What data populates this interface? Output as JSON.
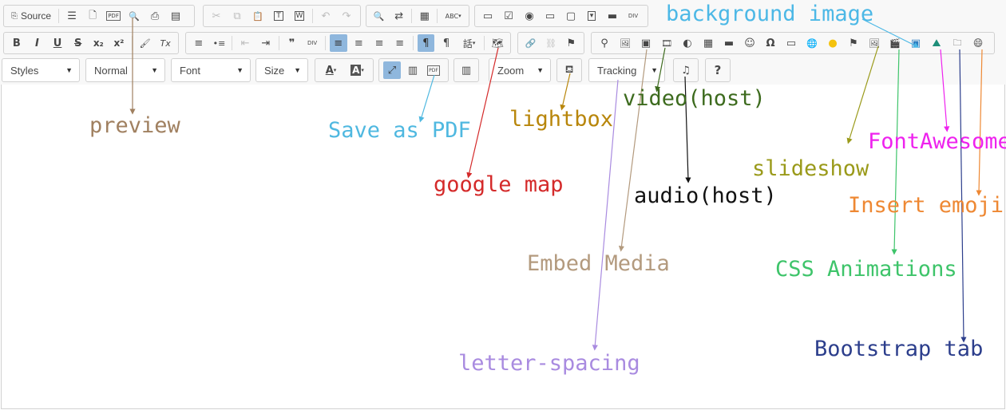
{
  "toolbar": {
    "source_label": "Source",
    "row1_glyphs": {
      "show_blocks": "☰",
      "new_page": "🗋",
      "pdf": "PDF",
      "preview": "🔍",
      "print": "⎙",
      "templates": "▤",
      "cut": "✂",
      "copy": "⧉",
      "paste": "📋",
      "paste_text": "T",
      "paste_word": "W",
      "undo": "↶",
      "redo": "↷",
      "find": "🔍",
      "replace": "⇄",
      "select_all": "▦",
      "spell": "ABC",
      "form": "▭",
      "checkbox": "☑",
      "radio": "◉",
      "textfield": "▭",
      "textarea": "▢",
      "select": "▾",
      "button": "▬",
      "div": "DIV"
    },
    "row2_glyphs": {
      "bold": "B",
      "italic": "I",
      "underline": "U",
      "strike": "S",
      "subscript": "x₂",
      "superscript": "x²",
      "copy_format": "🖌",
      "remove_format": "Tx",
      "numbered_list": "≡",
      "bulleted_list": "•≡",
      "outdent": "⇤",
      "indent": "⇥",
      "blockquote": "❞",
      "div_container": "DIV",
      "align_left": "≡",
      "align_center": "≡",
      "align_right": "≡",
      "justify": "≡",
      "ltr": "¶",
      "rtl": "¶",
      "language": "話",
      "google_map": "🗺",
      "link": "🔗",
      "unlink": "⛓",
      "anchor": "⚑",
      "location": "⚲",
      "image": "🖼",
      "embed_media": "▣",
      "video": "🎞",
      "flash": "◐",
      "table": "▦",
      "hr": "▬",
      "smiley": "☺",
      "special_char": "Ω",
      "iframe": "▭",
      "globe": "🌐",
      "circle": "●",
      "flag": "⚑",
      "slideshow": "🖼",
      "css_anim": "🎬",
      "background_image": "▣",
      "fontawesome": "⛰",
      "bootstrap_tab": "🗀",
      "emoji": "😄"
    },
    "styles_label": "Styles",
    "format_label": "Normal",
    "font_label": "Font",
    "size_label": "Size",
    "text_color": "A",
    "bg_color": "A",
    "maximize": "⤢",
    "show_blocks2": "▥",
    "save_pdf": "PDF",
    "columns": "▥",
    "zoom_label": "Zoom",
    "lightbox": "⛾",
    "tracking_label": "Tracking",
    "audio": "♫",
    "help": "?"
  },
  "annotations": {
    "preview": "preview",
    "save_as_pdf": "Save as PDF",
    "google_map": "google map",
    "lightbox": "lightbox",
    "video_host": "video(host)",
    "audio_host": "audio(host)",
    "embed_media": "Embed Media",
    "letter_spacing": "letter-spacing",
    "background_image": "background image",
    "slideshow": "slideshow",
    "fontawesome": "FontAwesome",
    "insert_emoji": "Insert emoji",
    "css_animations": "CSS Animations",
    "bootstrap_tab": "Bootstrap tab"
  },
  "colors": {
    "preview": "#a08060",
    "save_as_pdf": "#4fb8e0",
    "google_map": "#d42a2a",
    "lightbox": "#b8860b",
    "video_host": "#3d6b1e",
    "audio_host": "#111111",
    "embed_media": "#b39a7e",
    "letter_spacing": "#a98be0",
    "background_image": "#4cb8e6",
    "slideshow": "#9a9a1a",
    "fontawesome": "#ee22ee",
    "insert_emoji": "#ee8833",
    "css_animations": "#3ec46a",
    "bootstrap_tab": "#2c3e8c"
  }
}
